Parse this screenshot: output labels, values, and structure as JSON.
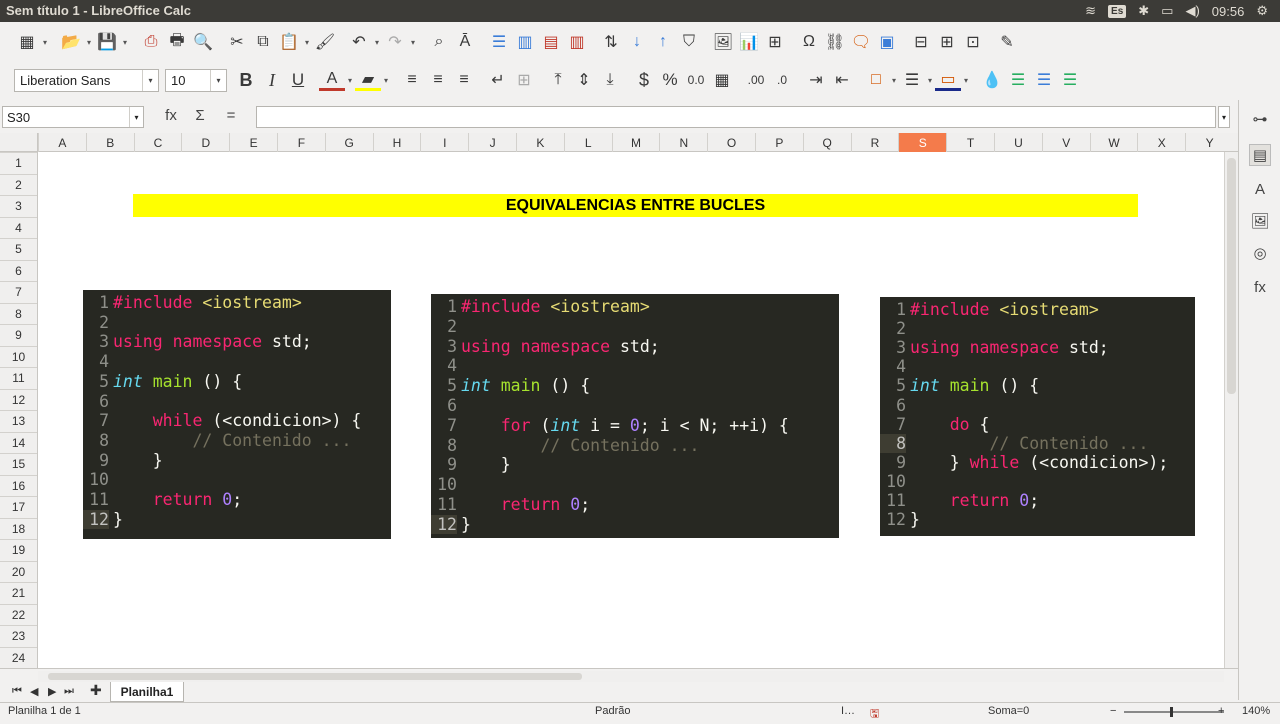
{
  "window": {
    "title": "Sem título 1 - LibreOffice Calc"
  },
  "tray": {
    "keyboard": "Es",
    "time": "09:56"
  },
  "toolbar2": {
    "font_name": "Liberation Sans",
    "font_size": "10"
  },
  "formula_bar": {
    "cell_ref": "S30",
    "fx": "fx",
    "sigma": "Σ",
    "equals": "=",
    "value": ""
  },
  "columns": [
    "A",
    "B",
    "C",
    "D",
    "E",
    "F",
    "G",
    "H",
    "I",
    "J",
    "K",
    "L",
    "M",
    "N",
    "O",
    "P",
    "Q",
    "R",
    "S",
    "T",
    "U",
    "V",
    "W",
    "X",
    "Y"
  ],
  "active_column": "S",
  "rows": [
    "1",
    "2",
    "3",
    "4",
    "5",
    "6",
    "7",
    "8",
    "9",
    "10",
    "11",
    "12",
    "13",
    "14",
    "15",
    "16",
    "17",
    "18",
    "19",
    "20",
    "21",
    "22",
    "23",
    "24"
  ],
  "banner": {
    "text": "EQUIVALENCIAS ENTRE BUCLES",
    "color": "#ffff00"
  },
  "code_panels": [
    {
      "name": "while-loop",
      "lines": [
        "#include <iostream>",
        "",
        "using namespace std;",
        "",
        "int main () {",
        "",
        "    while (<condicion>) {",
        "        // Contenido ...",
        "    }",
        "",
        "    return 0;",
        "}"
      ]
    },
    {
      "name": "for-loop",
      "lines": [
        "#include <iostream>",
        "",
        "using namespace std;",
        "",
        "int main () {",
        "",
        "    for (int i = 0; i < N; ++i) {",
        "        // Contenido ...",
        "    }",
        "",
        "    return 0;",
        "}"
      ]
    },
    {
      "name": "do-while-loop",
      "lines": [
        "#include <iostream>",
        "",
        "using namespace std;",
        "",
        "int main () {",
        "",
        "    do {",
        "        // Contenido ...",
        "    } while (<condicion>);",
        "",
        "    return 0;",
        "}"
      ]
    }
  ],
  "sheet": {
    "tab_label": "Planilha1"
  },
  "status": {
    "sheet_info": "Planilha 1 de 1",
    "style": "Padrão",
    "sum": "Soma=0",
    "zoom": "140%"
  },
  "colors": {
    "editor_bg": "#272822",
    "active_column_bg": "#f47b4b"
  }
}
